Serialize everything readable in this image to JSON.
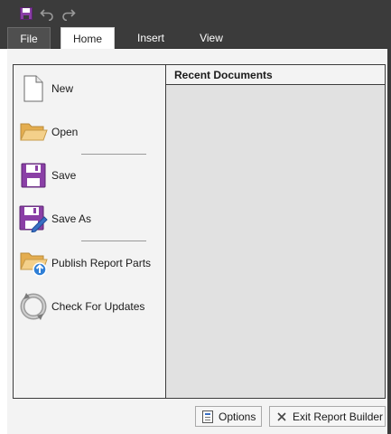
{
  "tabs": [
    {
      "label": "File"
    },
    {
      "label": "Home"
    },
    {
      "label": "Insert"
    },
    {
      "label": "View"
    }
  ],
  "quick_access": [
    "save-icon",
    "undo-icon",
    "redo-icon"
  ],
  "backstage": {
    "menu": [
      {
        "label": "New",
        "icon": "new-document-icon"
      },
      {
        "label": "Open",
        "icon": "open-folder-icon"
      },
      {
        "label": "Save",
        "icon": "save-icon"
      },
      {
        "label": "Save As",
        "icon": "save-as-icon"
      },
      {
        "label": "Publish Report Parts",
        "icon": "publish-report-parts-icon"
      },
      {
        "label": "Check For Updates",
        "icon": "check-for-updates-icon"
      }
    ],
    "recent_documents_title": "Recent Documents"
  },
  "footer": {
    "options_label": "Options",
    "exit_label": "Exit Report Builder"
  },
  "colors": {
    "chrome_dark": "#3b3b3b",
    "save_purple": "#8a3fa6",
    "folder_yellow": "#f1c56b",
    "recent_panel": "#e1e1e1"
  }
}
